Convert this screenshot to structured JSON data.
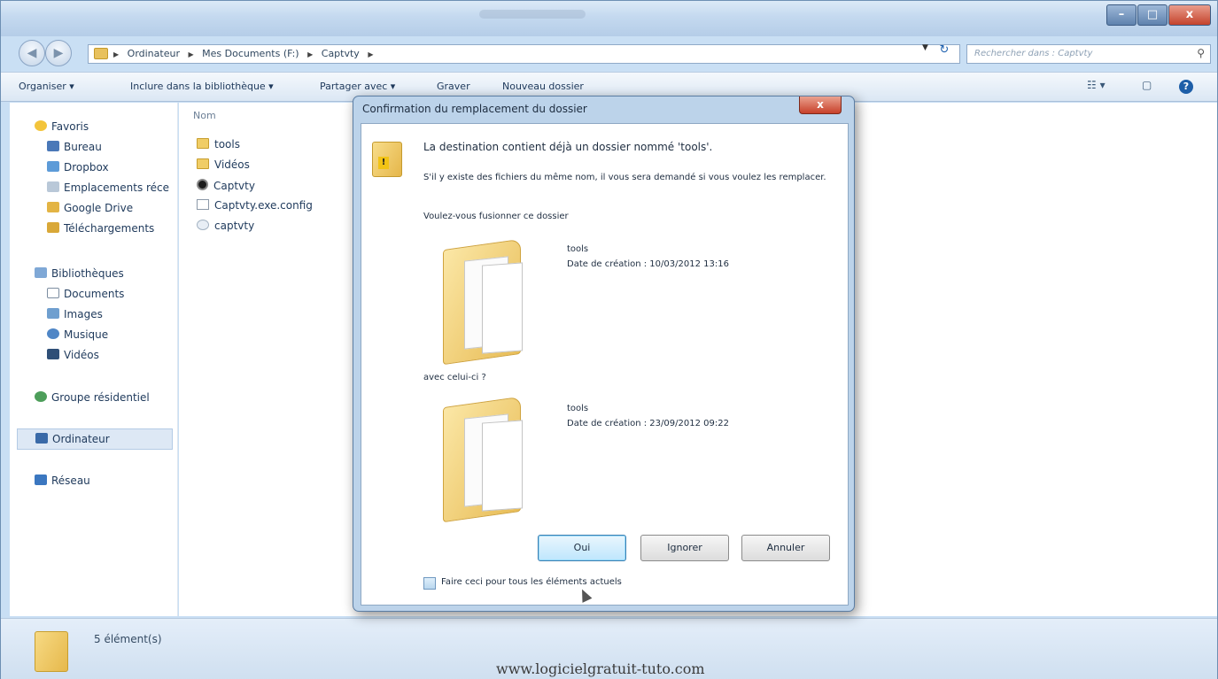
{
  "window": {
    "controls": {
      "minimize": "–",
      "maximize": "□",
      "close": "x"
    }
  },
  "address": {
    "back": "◀",
    "forward": "▶",
    "crumbs": [
      "Ordinateur",
      "Mes Documents (F:)",
      "Captvty"
    ],
    "search_placeholder": "Rechercher dans : Captvty"
  },
  "toolbar": {
    "organize": "Organiser ▾",
    "include_library": "Inclure dans la bibliothèque ▾",
    "share_with": "Partager avec ▾",
    "burn": "Graver",
    "new_folder": "Nouveau dossier",
    "view": "☷ ▾",
    "preview": "▢",
    "help": "?"
  },
  "sidebar": {
    "favorites": "Favoris",
    "favorites_items": [
      "Bureau",
      "Dropbox",
      "Emplacements réce",
      "Google Drive",
      "Téléchargements"
    ],
    "libraries": "Bibliothèques",
    "libraries_items": [
      "Documents",
      "Images",
      "Musique",
      "Vidéos"
    ],
    "homegroup": "Groupe résidentiel",
    "computer": "Ordinateur",
    "network": "Réseau"
  },
  "content": {
    "column_name": "Nom",
    "files": [
      {
        "name": "tools",
        "type": "folder"
      },
      {
        "name": "Vidéos",
        "type": "folder"
      },
      {
        "name": "Captvty",
        "type": "exe"
      },
      {
        "name": "Captvty.exe.config",
        "type": "doc"
      },
      {
        "name": "captvty",
        "type": "file"
      }
    ]
  },
  "status": {
    "count": "5 élément(s)"
  },
  "watermark": "www.logicielgratuit-tuto.com",
  "dialog": {
    "title": "Confirmation du remplacement du dossier",
    "close": "x",
    "headline": "La destination contient déjà un dossier nommé 'tools'.",
    "detail": "S'il y existe des fichiers du même nom, il vous sera demandé si vous voulez les remplacer.",
    "question": "Voulez-vous fusionner ce dossier",
    "with_this": "avec celui-ci ?",
    "dest_folder": {
      "name": "tools",
      "created": "Date de création : 10/03/2012 13:16"
    },
    "src_folder": {
      "name": "tools",
      "created": "Date de création : 23/09/2012 09:22"
    },
    "buttons": {
      "yes": "Oui",
      "skip": "Ignorer",
      "cancel": "Annuler"
    },
    "apply_all": "Faire ceci pour tous les éléments actuels",
    "apply_all_checked": false
  }
}
